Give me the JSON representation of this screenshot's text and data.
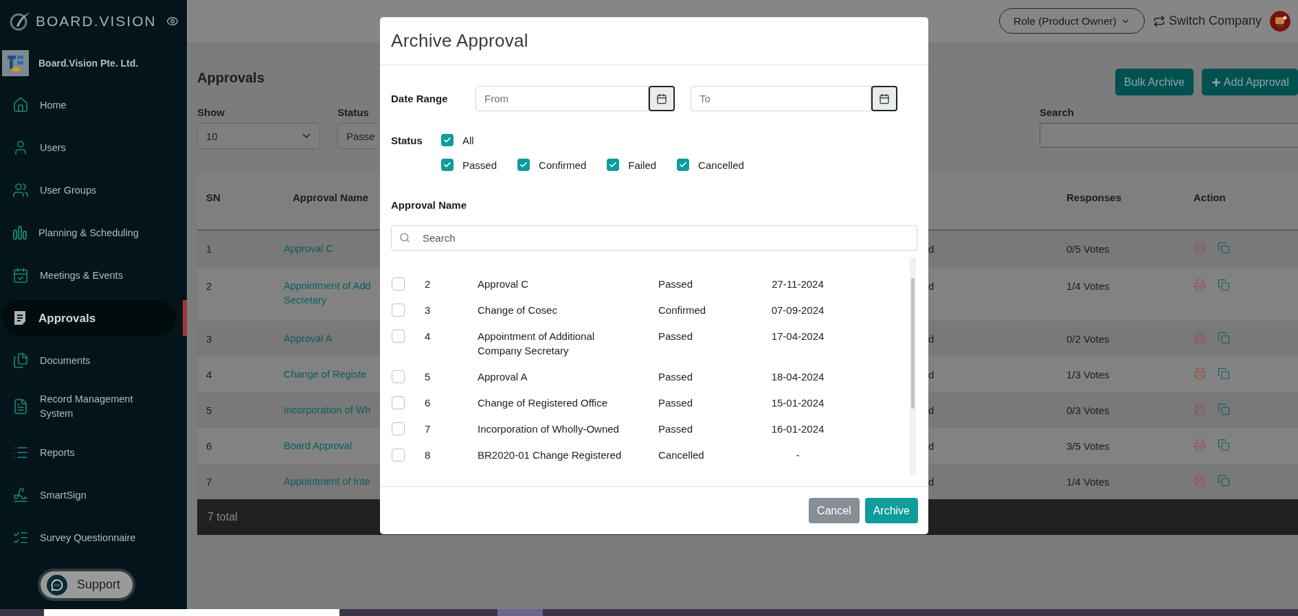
{
  "sidebar": {
    "brand": "BOARD.VISION",
    "company": "Board.Vision Pte. Ltd.",
    "items": [
      {
        "label": "Home",
        "selected": false
      },
      {
        "label": "Users",
        "selected": false
      },
      {
        "label": "User Groups",
        "selected": false
      },
      {
        "label": "Planning & Scheduling",
        "selected": false
      },
      {
        "label": "Meetings & Events",
        "selected": false
      },
      {
        "label": "Approvals",
        "selected": true
      },
      {
        "label": "Documents",
        "selected": false
      },
      {
        "label": "Record Management System",
        "selected": false
      },
      {
        "label": "Reports",
        "selected": false
      },
      {
        "label": "SmartSign",
        "selected": false
      },
      {
        "label": "Survey Questionnaire",
        "selected": false
      }
    ],
    "support": "Support"
  },
  "topbar": {
    "role": "Role (Product Owner)",
    "switch": "Switch Company"
  },
  "page": {
    "title": "Approvals",
    "buttons": [
      {
        "label": "Bulk Archive",
        "kind": "plain"
      },
      {
        "label": "Add Approval",
        "kind": "add"
      }
    ],
    "filters": {
      "show_label": "Show",
      "show_value": "10",
      "status_label": "Status",
      "status_value": "Passe",
      "search_label": "Search"
    }
  },
  "table": {
    "columns": [
      "SN",
      "Approval Name",
      "Responses",
      "Action"
    ],
    "rows": [
      {
        "sn": "1",
        "name": "Approval C",
        "column_3": "d",
        "responses": "0/5 Votes"
      },
      {
        "sn": "2",
        "name": "Appointment of Add\nSecretary",
        "column_3": "d",
        "responses": "1/4 Votes"
      },
      {
        "sn": "3",
        "name": "Approval A",
        "column_3": "d",
        "responses": "0/2 Votes"
      },
      {
        "sn": "4",
        "name": "Change of Registe",
        "column_3": "d",
        "responses": "1/3 Votes"
      },
      {
        "sn": "5",
        "name": "Incorporation of Wh",
        "column_3": "d",
        "responses": "0/3 Votes"
      },
      {
        "sn": "6",
        "name": "Board Approval",
        "column_3": "d",
        "responses": "3/5 Votes"
      },
      {
        "sn": "7",
        "name": "Appointment of Inte",
        "column_3": "d",
        "responses": "1/4 Votes"
      }
    ],
    "footer": "7 total"
  },
  "modal": {
    "title": "Archive Approval",
    "date_label": "Date Range",
    "from_placeholder": "From",
    "to_placeholder": "To",
    "status_label": "Status",
    "status_all": {
      "label": "All",
      "checked": true
    },
    "status_options": [
      {
        "label": "Passed",
        "checked": true
      },
      {
        "label": "Confirmed",
        "checked": true
      },
      {
        "label": "Failed",
        "checked": true
      },
      {
        "label": "Cancelled",
        "checked": true
      }
    ],
    "name_label": "Approval Name",
    "search_placeholder": "Search",
    "rows": [
      {
        "sn": "2",
        "name": "Approval C",
        "status": "Passed",
        "date": "27-11-2024",
        "checked": false
      },
      {
        "sn": "3",
        "name": "Change of Cosec",
        "status": "Confirmed",
        "date": "07-09-2024",
        "checked": false
      },
      {
        "sn": "4",
        "name": "Appointment of Additional Company Secretary",
        "status": "Passed",
        "date": "17-04-2024",
        "checked": false
      },
      {
        "sn": "5",
        "name": "Approval A",
        "status": "Passed",
        "date": "18-04-2024",
        "checked": false
      },
      {
        "sn": "6",
        "name": "Change of Registered Office",
        "status": "Passed",
        "date": "15-01-2024",
        "checked": false
      },
      {
        "sn": "7",
        "name": "Incorporation of Wholly-Owned",
        "status": "Passed",
        "date": "16-01-2024",
        "checked": false
      },
      {
        "sn": "8",
        "name": "BR2020-01 Change Registered",
        "status": "Cancelled",
        "date": "-",
        "checked": false
      }
    ],
    "buttons": [
      {
        "label": "Cancel",
        "kind": "secondary"
      },
      {
        "label": "Archive",
        "kind": "primary"
      }
    ]
  }
}
